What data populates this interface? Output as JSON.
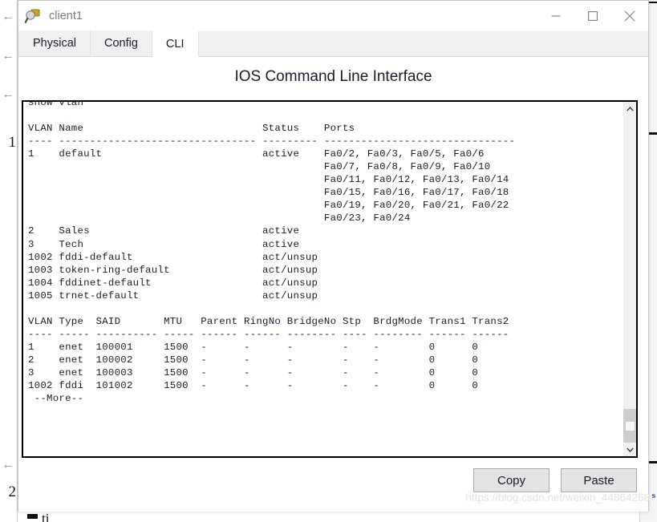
{
  "window": {
    "title": "client1",
    "icon": "magnifier-network-icon",
    "controls": {
      "minimize": "minimize-icon",
      "maximize": "maximize-icon",
      "close": "close-icon"
    }
  },
  "tabs": [
    {
      "label": "Physical",
      "active": false
    },
    {
      "label": "Config",
      "active": false
    },
    {
      "label": "CLI",
      "active": true
    }
  ],
  "panel": {
    "title": "IOS Command Line Interface"
  },
  "terminal": {
    "clipped_top_line": "show vlan",
    "content": "show vlan\n\nVLAN Name                             Status    Ports\n---- -------------------------------- --------- -------------------------------\n1    default                          active    Fa0/2, Fa0/3, Fa0/5, Fa0/6\n                                                Fa0/7, Fa0/8, Fa0/9, Fa0/10\n                                                Fa0/11, Fa0/12, Fa0/13, Fa0/14\n                                                Fa0/15, Fa0/16, Fa0/17, Fa0/18\n                                                Fa0/19, Fa0/20, Fa0/21, Fa0/22\n                                                Fa0/23, Fa0/24\n2    Sales                            active\n3    Tech                             active\n1002 fddi-default                     act/unsup\n1003 token-ring-default               act/unsup\n1004 fddinet-default                  act/unsup\n1005 trnet-default                    act/unsup\n\nVLAN Type  SAID       MTU   Parent RingNo BridgeNo Stp  BrdgMode Trans1 Trans2\n---- ----- ---------- ----- ------ ------ -------- ---- -------- ------ ------\n1    enet  100001     1500  -      -      -        -    -        0      0\n2    enet  100002     1500  -      -      -        -    -        0      0\n3    enet  100003     1500  -      -      -        -    -        0      0\n1002 fddi  101002     1500  -      -      -        -    -        0      0\n --More--",
    "vlan_table": {
      "headers": [
        "VLAN",
        "Name",
        "Status",
        "Ports"
      ],
      "rows": [
        {
          "vlan": "1",
          "name": "default",
          "status": "active",
          "ports": [
            "Fa0/2, Fa0/3, Fa0/5, Fa0/6",
            "Fa0/7, Fa0/8, Fa0/9, Fa0/10",
            "Fa0/11, Fa0/12, Fa0/13, Fa0/14",
            "Fa0/15, Fa0/16, Fa0/17, Fa0/18",
            "Fa0/19, Fa0/20, Fa0/21, Fa0/22",
            "Fa0/23, Fa0/24"
          ]
        },
        {
          "vlan": "2",
          "name": "Sales",
          "status": "active",
          "ports": []
        },
        {
          "vlan": "3",
          "name": "Tech",
          "status": "active",
          "ports": []
        },
        {
          "vlan": "1002",
          "name": "fddi-default",
          "status": "act/unsup",
          "ports": []
        },
        {
          "vlan": "1003",
          "name": "token-ring-default",
          "status": "act/unsup",
          "ports": []
        },
        {
          "vlan": "1004",
          "name": "fddinet-default",
          "status": "act/unsup",
          "ports": []
        },
        {
          "vlan": "1005",
          "name": "trnet-default",
          "status": "act/unsup",
          "ports": []
        }
      ]
    },
    "type_table": {
      "headers": [
        "VLAN",
        "Type",
        "SAID",
        "MTU",
        "Parent",
        "RingNo",
        "BridgeNo",
        "Stp",
        "BrdgMode",
        "Trans1",
        "Trans2"
      ],
      "rows": [
        [
          "1",
          "enet",
          "100001",
          "1500",
          "-",
          "-",
          "-",
          "-",
          "-",
          "0",
          "0"
        ],
        [
          "2",
          "enet",
          "100002",
          "1500",
          "-",
          "-",
          "-",
          "-",
          "-",
          "0",
          "0"
        ],
        [
          "3",
          "enet",
          "100003",
          "1500",
          "-",
          "-",
          "-",
          "-",
          "-",
          "0",
          "0"
        ],
        [
          "1002",
          "fddi",
          "101002",
          "1500",
          "-",
          "-",
          "-",
          "-",
          "-",
          "0",
          "0"
        ]
      ]
    },
    "pager_prompt": " --More--",
    "scrollbar": {
      "up_arrow": "chevron-up-icon",
      "down_arrow": "chevron-down-icon"
    }
  },
  "footer": {
    "copy_label": "Copy",
    "paste_label": "Paste"
  },
  "watermark": "https://blog.csdn.net/weixin_44864268",
  "background": {
    "numbers": [
      "1",
      "2"
    ],
    "arrow_glyph": "←",
    "label_s": "s"
  },
  "colors": {
    "tab_active_bg": "#ffffff",
    "tab_inactive_bg": "#f0f0f0",
    "terminal_border": "#000000",
    "button_bg": "#e3e3e3",
    "text": "#1b1b2e",
    "title_text": "#7a7a7a",
    "watermark": "#e3e3e3"
  }
}
